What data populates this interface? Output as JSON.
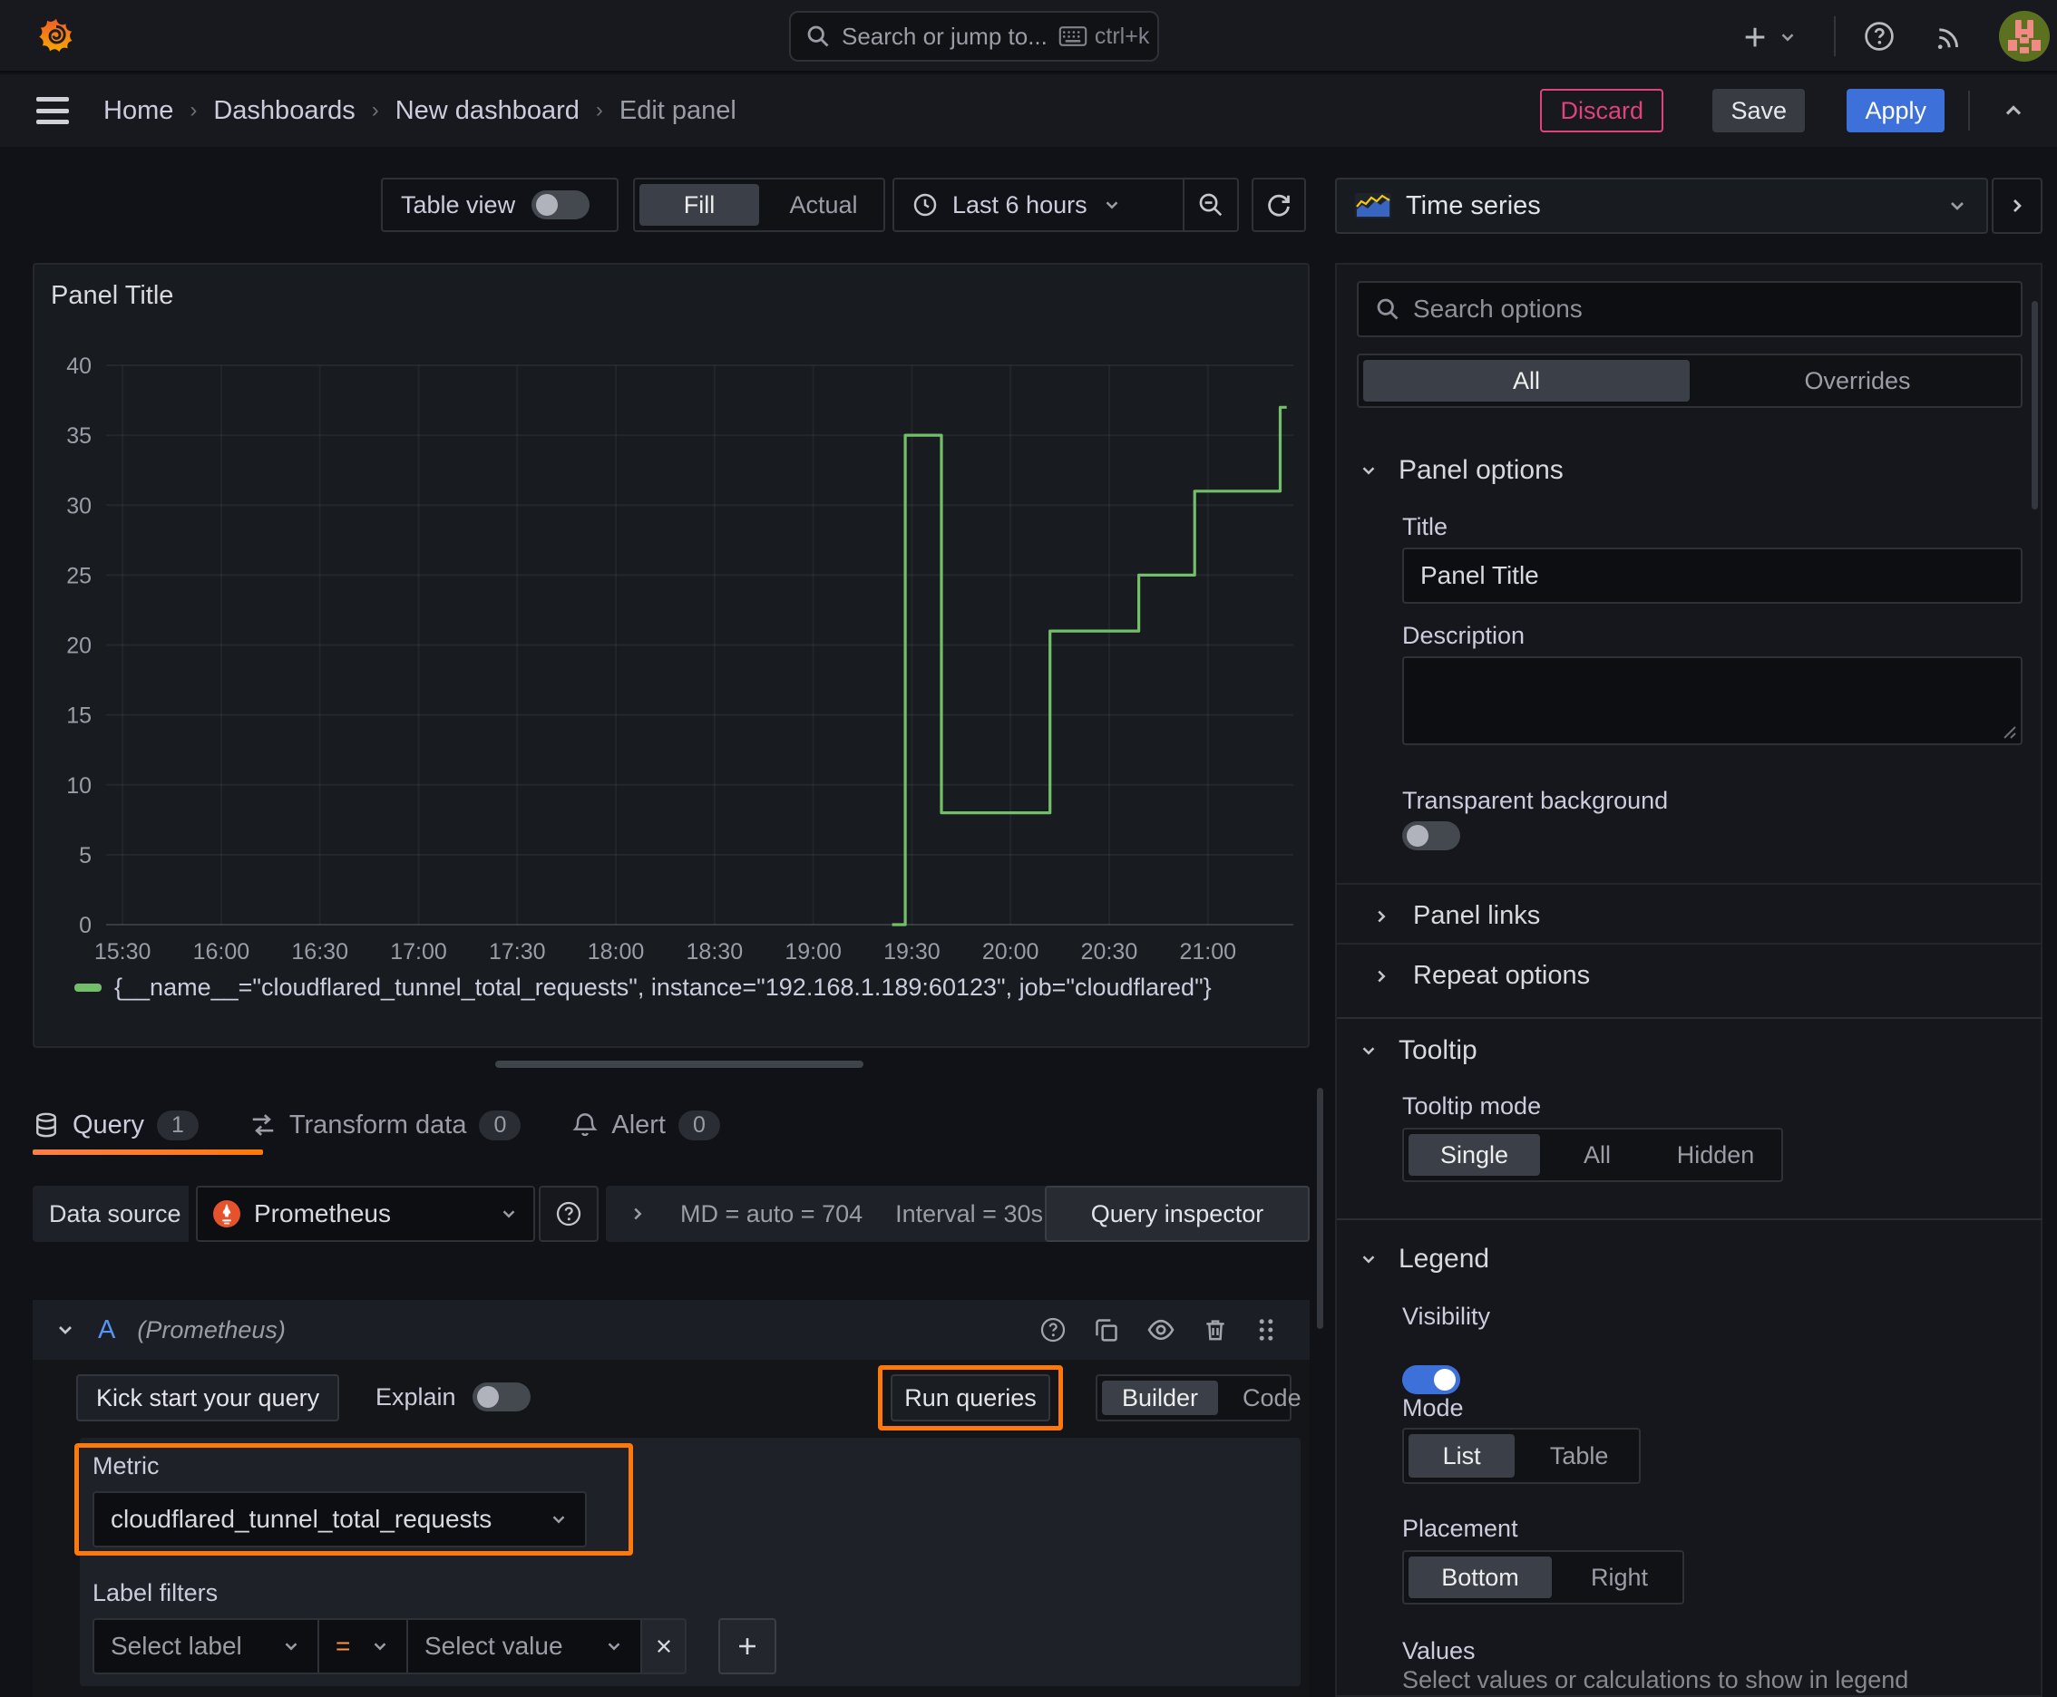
{
  "topbar": {
    "search_placeholder": "Search or jump to...",
    "shortcut_hint": "ctrl+k"
  },
  "breadcrumb": {
    "items": [
      "Home",
      "Dashboards",
      "New dashboard",
      "Edit panel"
    ]
  },
  "actions": {
    "discard": "Discard",
    "save": "Save",
    "apply": "Apply"
  },
  "toolbar": {
    "table_view_label": "Table view",
    "fill_label": "Fill",
    "actual_label": "Actual",
    "time_range_label": "Last 6 hours"
  },
  "panel": {
    "title": "Panel Title"
  },
  "chart_data": {
    "type": "line",
    "title": "Panel Title",
    "x_ticks": [
      "15:30",
      "16:00",
      "16:30",
      "17:00",
      "17:30",
      "18:00",
      "18:30",
      "19:00",
      "19:30",
      "20:00",
      "20:30",
      "21:00"
    ],
    "x_range": [
      "15:25",
      "21:26"
    ],
    "y_ticks": [
      0,
      5,
      10,
      15,
      20,
      25,
      30,
      35,
      40
    ],
    "ylim": [
      0,
      40
    ],
    "grid": true,
    "legend_position": "bottom",
    "series": [
      {
        "name": "{__name__=\"cloudflared_tunnel_total_requests\", instance=\"192.168.1.189:60123\", job=\"cloudflared\"}",
        "color": "#73bf69",
        "points": [
          [
            "19:24",
            0
          ],
          [
            "19:28",
            0
          ],
          [
            "19:28",
            35
          ],
          [
            "19:39",
            35
          ],
          [
            "19:39",
            8
          ],
          [
            "20:12",
            8
          ],
          [
            "20:12",
            21
          ],
          [
            "20:39",
            21
          ],
          [
            "20:39",
            25
          ],
          [
            "20:56",
            25
          ],
          [
            "20:56",
            31
          ],
          [
            "21:22",
            31
          ],
          [
            "21:22",
            37
          ],
          [
            "21:24",
            37
          ]
        ]
      }
    ]
  },
  "tabs": {
    "query": "Query",
    "query_count": "1",
    "transform": "Transform data",
    "transform_count": "0",
    "alert": "Alert",
    "alert_count": "0"
  },
  "datasource": {
    "label": "Data source",
    "name": "Prometheus",
    "md_stat": "MD = auto = 704",
    "interval_stat": "Interval = 30s",
    "inspector": "Query inspector"
  },
  "query": {
    "ref_id": "A",
    "ds_hint": "(Prometheus)",
    "kick_start": "Kick start your query",
    "explain": "Explain",
    "run": "Run queries",
    "builder": "Builder",
    "code": "Code",
    "metric_label": "Metric",
    "metric_value": "cloudflared_tunnel_total_requests",
    "filters_label": "Label filters",
    "select_label": "Select label",
    "operator": "=",
    "select_value": "Select value",
    "remove": "x",
    "add": "+"
  },
  "options": {
    "viz": "Time series",
    "search_placeholder": "Search options",
    "all": "All",
    "overrides": "Overrides",
    "panel_options": "Panel options",
    "title_label": "Title",
    "title_value": "Panel Title",
    "description_label": "Description",
    "transparent": "Transparent background",
    "panel_links": "Panel links",
    "repeat": "Repeat options",
    "tooltip": "Tooltip",
    "tooltip_mode": "Tooltip mode",
    "single": "Single",
    "all2": "All",
    "hidden": "Hidden",
    "legend": "Legend",
    "visibility": "Visibility",
    "mode": "Mode",
    "list": "List",
    "table": "Table",
    "placement": "Placement",
    "bottom": "Bottom",
    "right": "Right",
    "values": "Values",
    "values_desc": "Select values or calculations to show in legend"
  },
  "colors": {
    "accent_orange": "#ff780a",
    "primary_blue": "#3d71d9",
    "series_green": "#73bf69",
    "destructive_pink": "#e0437a",
    "prometheus_orange": "#e6522c",
    "link_blue": "#5794f2"
  }
}
